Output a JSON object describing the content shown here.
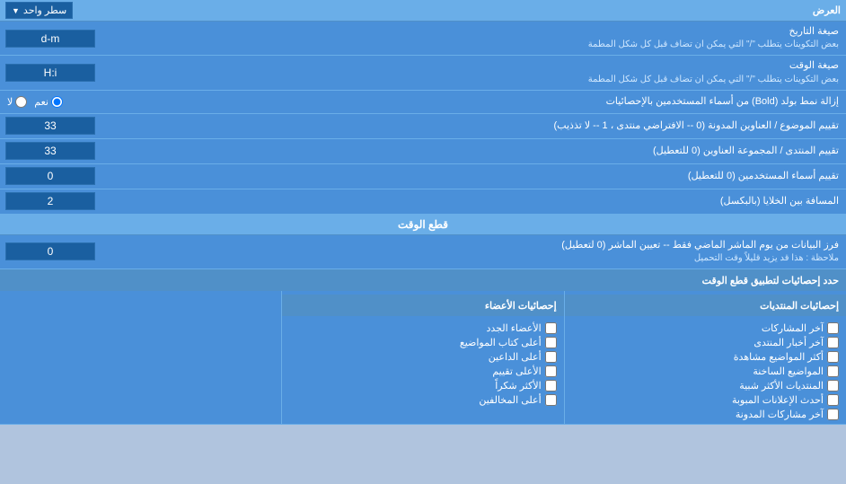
{
  "header": {
    "label": "العرض",
    "dropdown_label": "سطر واحد",
    "dropdown_arrow": "▼"
  },
  "rows": [
    {
      "id": "date-format",
      "label": "صيغة التاريخ",
      "sublabel": "بعض التكوينات يتطلب \"/\" التي يمكن ان تضاف قبل كل شكل المطمة",
      "value": "d-m"
    },
    {
      "id": "time-format",
      "label": "صيغة الوقت",
      "sublabel": "بعض التكوينات يتطلب \"/\" التي يمكن ان تضاف قبل كل شكل المطمة",
      "value": "H:i"
    },
    {
      "id": "bold-remove",
      "label": "إزالة نمط بولد (Bold) من أسماء المستخدمين بالإحصائيات",
      "type": "radio",
      "options": [
        {
          "label": "نعم",
          "value": "yes",
          "checked": true
        },
        {
          "label": "لا",
          "value": "no",
          "checked": false
        }
      ]
    },
    {
      "id": "topics-order",
      "label": "تقييم الموضوع / العناوين المدونة (0 -- الافتراضي منتدى ، 1 -- لا تذذيب)",
      "value": "33"
    },
    {
      "id": "forums-order",
      "label": "تقييم المنتدى / المجموعة العناوين (0 للتعطيل)",
      "value": "33"
    },
    {
      "id": "users-order",
      "label": "تقييم أسماء المستخدمين (0 للتعطيل)",
      "value": "0"
    },
    {
      "id": "cells-distance",
      "label": "المسافة بين الخلايا (بالبكسل)",
      "value": "2"
    }
  ],
  "realtime_section": {
    "title": "قطع الوقت",
    "filter_row": {
      "label": "فرز البيانات من يوم الماشر الماضي فقط -- تعيين الماشر (0 لتعطيل)",
      "note": "ملاحظة : هذا قد يزيد قليلاً وقت التحميل",
      "value": "0"
    },
    "checkboxes_label": "حدد إحصائيات لتطبيق قطع الوقت",
    "columns": [
      {
        "header": "إحصائيات المنتديات",
        "items": [
          "آخر المشاركات",
          "آخر أخبار المنتدى",
          "أكثر المواضيع مشاهدة",
          "المواضيع الساخنة",
          "المنتديات الأكثر شبية",
          "أحدث الإعلانات المبوبة",
          "آخر مشاركات المدونة"
        ]
      },
      {
        "header": "إحصائيات الأعضاء",
        "items": [
          "الأعضاء الجدد",
          "أعلى كتاب المواضيع",
          "أعلى الداعين",
          "الأعلى تقييم",
          "الأكثر شكراً",
          "أعلى المخالفين"
        ]
      }
    ]
  }
}
